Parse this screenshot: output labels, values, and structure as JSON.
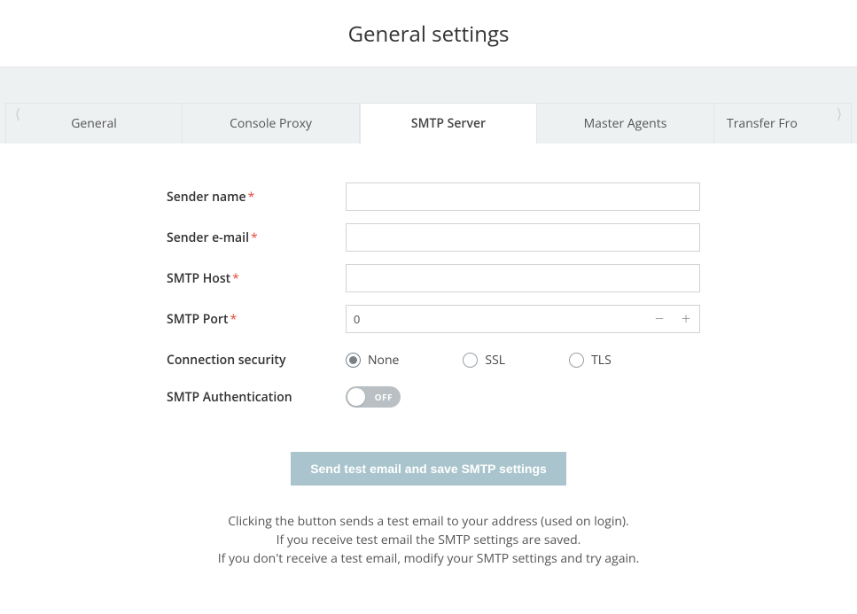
{
  "title": "General settings",
  "tabs": [
    {
      "label": "General",
      "active": false
    },
    {
      "label": "Console Proxy",
      "active": false
    },
    {
      "label": "SMTP Server",
      "active": true
    },
    {
      "label": "Master Agents",
      "active": false
    },
    {
      "label": "Transfer Fro",
      "active": false
    }
  ],
  "form": {
    "sender_name": {
      "label": "Sender name",
      "required": true,
      "value": ""
    },
    "sender_email": {
      "label": "Sender e-mail",
      "required": true,
      "value": ""
    },
    "smtp_host": {
      "label": "SMTP Host",
      "required": true,
      "value": ""
    },
    "smtp_port": {
      "label": "SMTP Port",
      "required": true,
      "value": "0"
    },
    "connection_security": {
      "label": "Connection security",
      "options": [
        "None",
        "SSL",
        "TLS"
      ],
      "selected": "None"
    },
    "smtp_auth": {
      "label": "SMTP Authentication",
      "state": "OFF"
    }
  },
  "actions": {
    "send_test_label": "Send test email and save SMTP settings"
  },
  "hints": {
    "line1": "Clicking the button sends a test email to your address (used on login).",
    "line2": "If you receive test email the SMTP settings are saved.",
    "line3": "If you don't receive a test email, modify your SMTP settings and try again."
  },
  "required_mark": "*"
}
